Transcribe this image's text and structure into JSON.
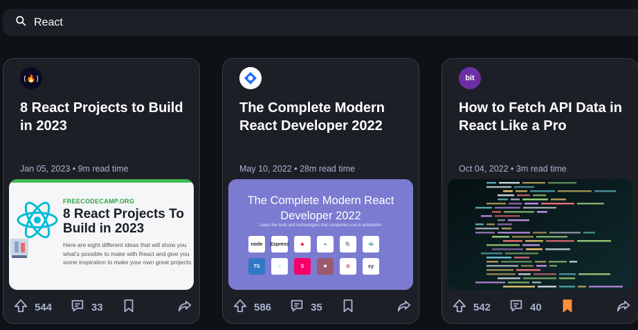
{
  "search": {
    "value": "React"
  },
  "cards": [
    {
      "source": "freeCodeCamp",
      "title": "8 React Projects to Build in 2023",
      "meta": "Jan 05, 2023 • 9m read time",
      "thumb": {
        "source_label": "FREECODECAMP.ORG",
        "heading": "8 React Projects To Build in 2023",
        "text": "Here are eight different ideas that will show you what's possible to make with React and give you some inspiration to make your own great projects"
      },
      "upvotes": "544",
      "comments": "33",
      "bookmarked": false
    },
    {
      "source": "daily.dev",
      "title": "The Complete Modern React Developer 2022",
      "meta": "May 10, 2022 • 28m read time",
      "thumb": {
        "heading": "The Complete Modern React Developer 2022",
        "sub": "Learn the tools and technologies that companies use in production",
        "tiles": [
          "node",
          "Express",
          "",
          "mongoDB",
          "PostgreSQL",
          "docker",
          "TS",
          "",
          "S",
          "",
          "",
          "cy"
        ]
      },
      "upvotes": "586",
      "comments": "35",
      "bookmarked": false
    },
    {
      "source": "bit",
      "source_logo_text": "bit",
      "title": "How to Fetch API Data in React Like a Pro",
      "meta": "Oct 04, 2022 • 3m read time",
      "upvotes": "542",
      "comments": "40",
      "bookmarked": true
    }
  ],
  "colors": {
    "background": "#0e1116",
    "card": "#1c1f26",
    "muted": "#a8b3cf",
    "bookmark_active": "#ff8e3b"
  }
}
